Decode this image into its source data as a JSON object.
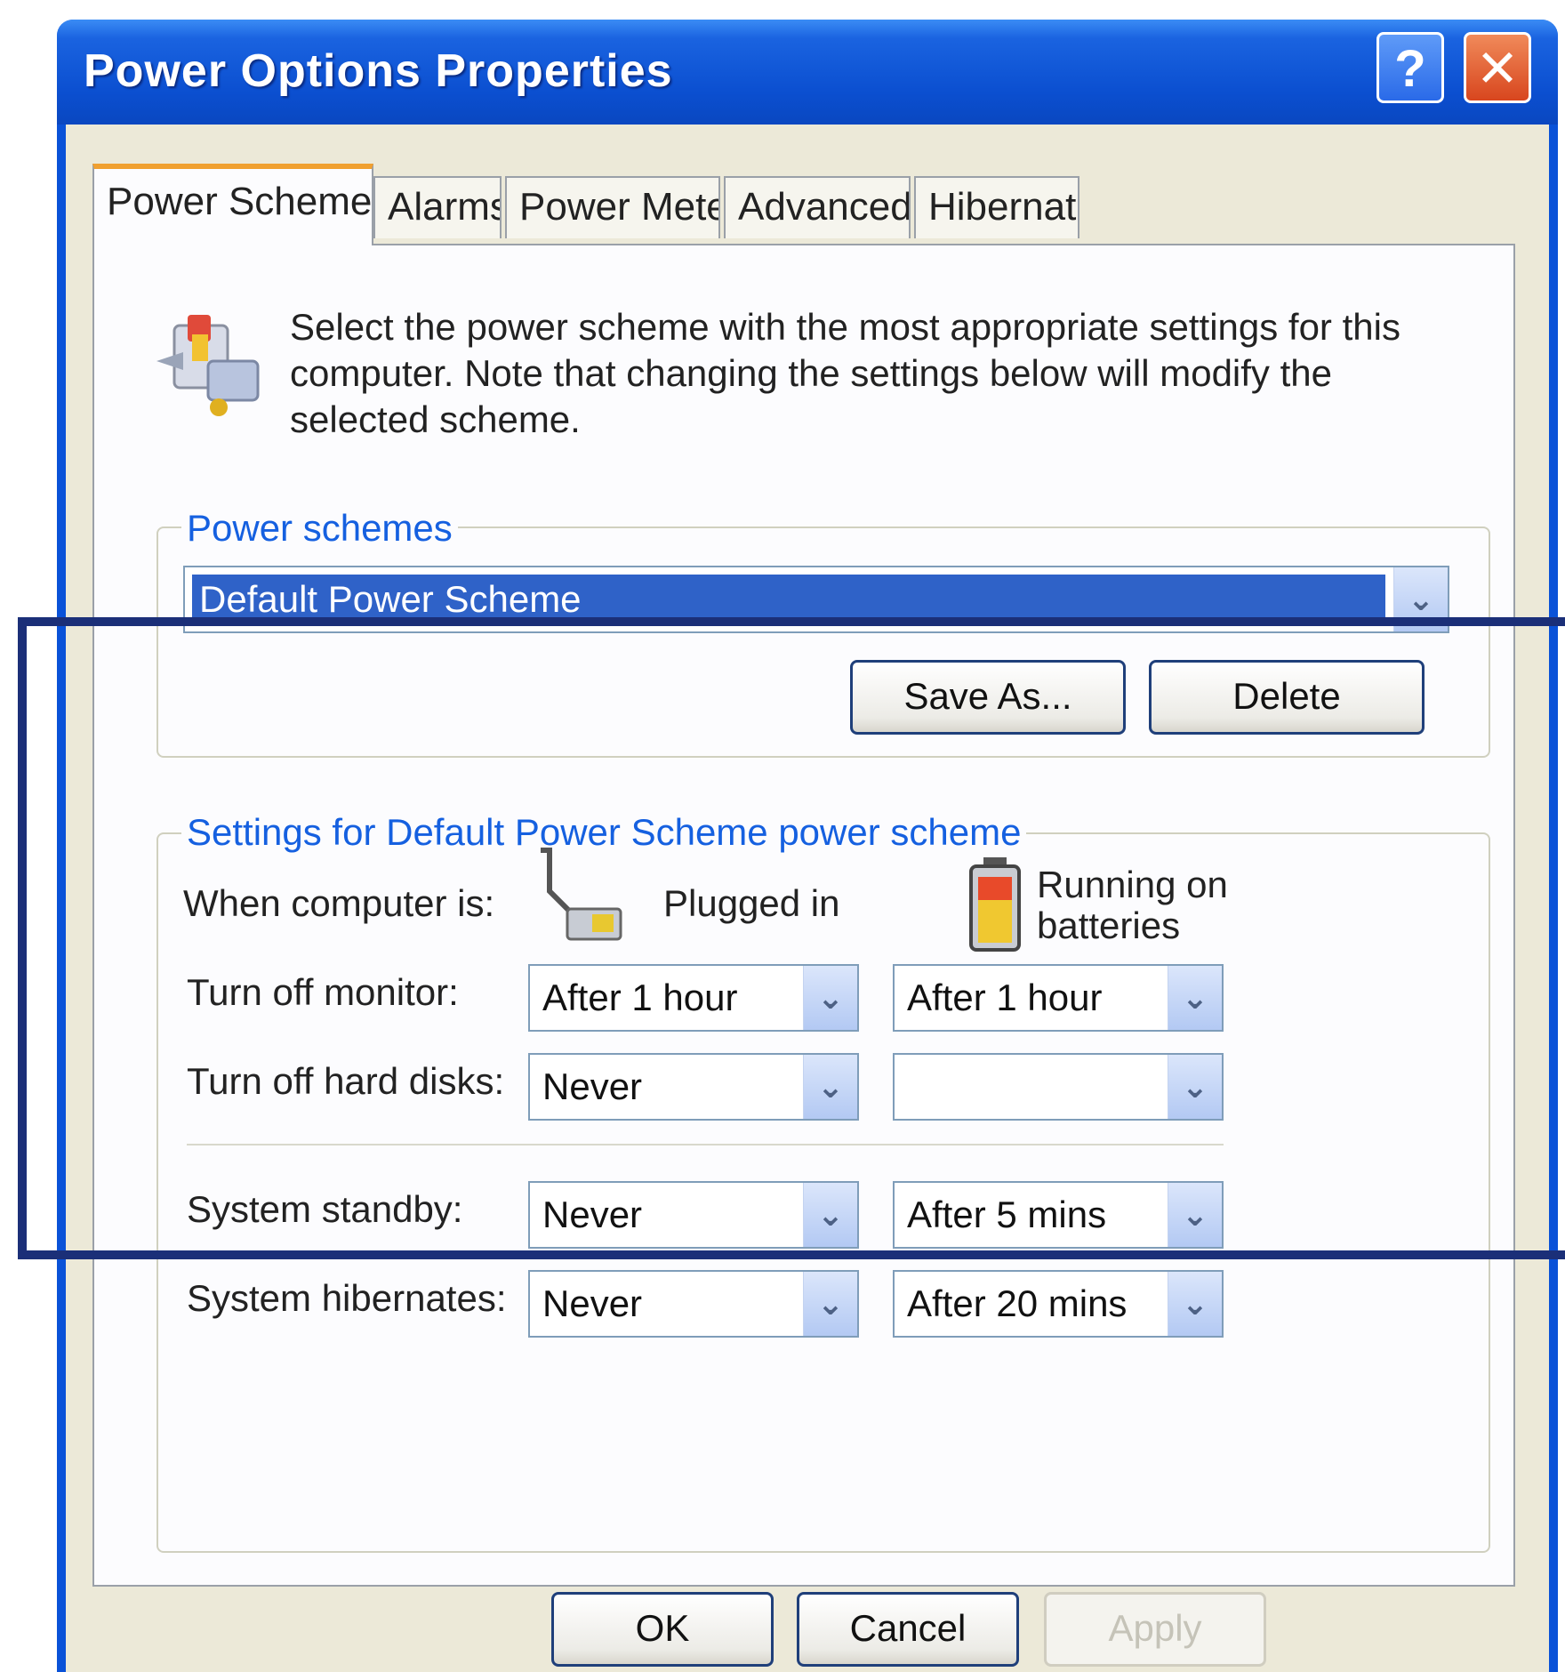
{
  "window": {
    "title": "Power Options Properties",
    "help_label": "?",
    "close_label": "✕"
  },
  "tabs": [
    {
      "label": "Power Schemes",
      "active": true
    },
    {
      "label": "Alarms",
      "active": false
    },
    {
      "label": "Power Meter",
      "active": false
    },
    {
      "label": "Advanced",
      "active": false
    },
    {
      "label": "Hibernate",
      "active": false
    }
  ],
  "description": "Select the power scheme with the most appropriate settings for this computer. Note that changing the settings below will modify the selected scheme.",
  "power_schemes": {
    "group_label": "Power schemes",
    "selected": "Default Power Scheme",
    "save_as_label": "Save As...",
    "delete_label": "Delete"
  },
  "settings": {
    "group_label": "Settings for Default Power Scheme power scheme",
    "when_label": "When computer is:",
    "plugged_in_label": "Plugged in",
    "batteries_label": "Running on batteries",
    "rows": [
      {
        "label": "Turn off monitor:",
        "plugged": "After 1 hour",
        "battery": "After 1 hour"
      },
      {
        "label": "Turn off hard disks:",
        "plugged": "Never",
        "battery": ""
      },
      {
        "label": "System standby:",
        "plugged": "Never",
        "battery": "After 5 mins"
      },
      {
        "label": "System hibernates:",
        "plugged": "Never",
        "battery": "After 20 mins"
      }
    ]
  },
  "footer": {
    "ok_label": "OK",
    "cancel_label": "Cancel",
    "apply_label": "Apply"
  },
  "colors": {
    "titlebar": "#0a52d8",
    "group_label": "#1560e0",
    "selection": "#2f62c8",
    "highlight_box": "#1b2f78"
  },
  "icons": {
    "scheme_icon": "power-scheme-icon",
    "plug_icon": "power-plug-icon",
    "battery_icon": "battery-icon",
    "dropdown_arrow": "chevron-down-icon"
  }
}
